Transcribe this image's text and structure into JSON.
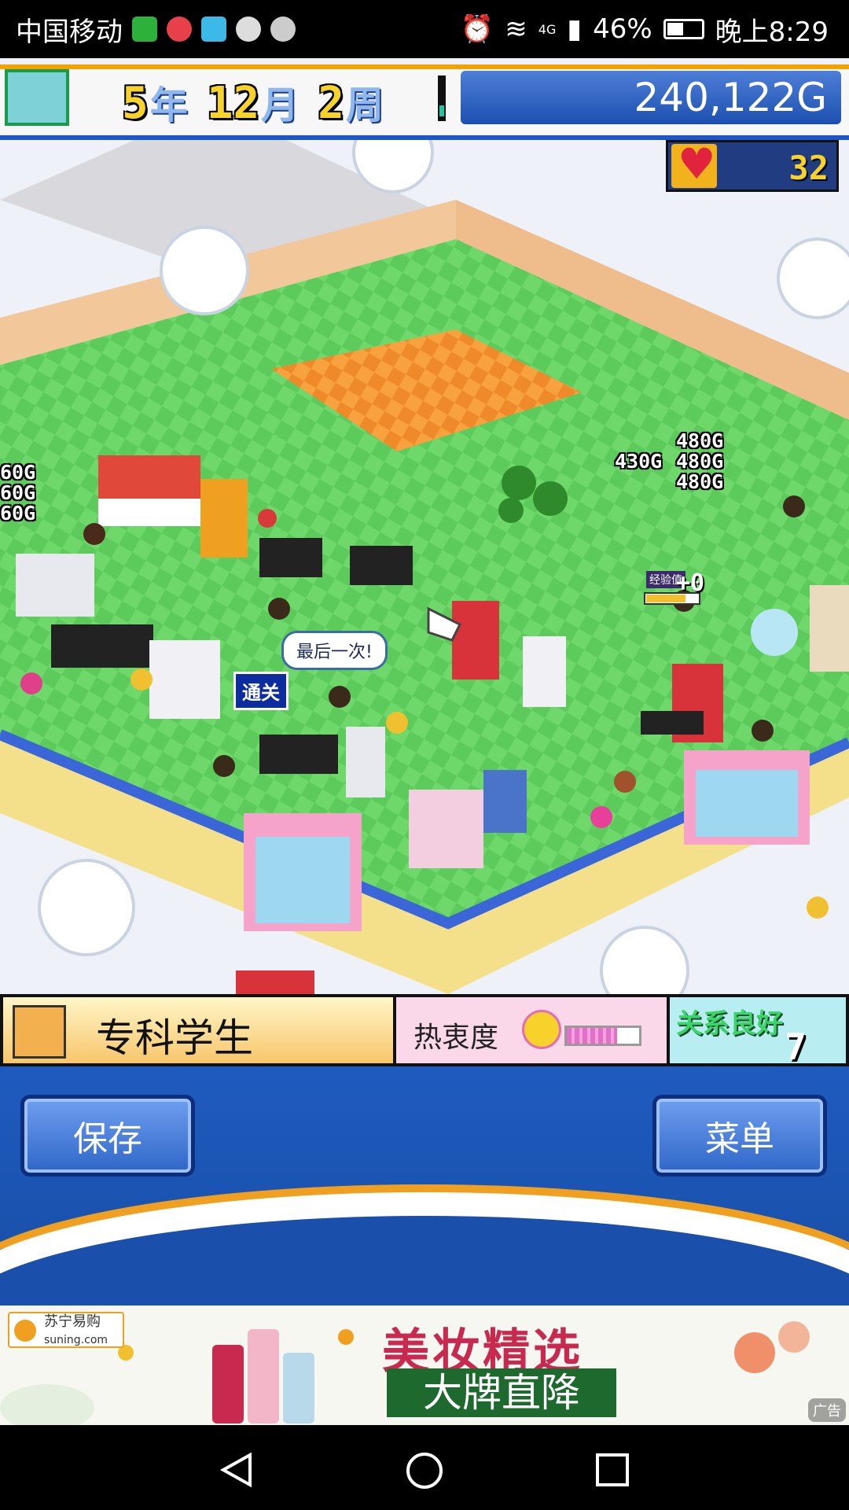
{
  "status_bar": {
    "carrier": "中国移动",
    "signal": "4G",
    "battery": "46%",
    "time": "晚上8:29"
  },
  "hud": {
    "year": "5",
    "year_unit": "年",
    "month": "12",
    "month_unit": "月",
    "week": "2",
    "week_unit": "周",
    "money": "240,122G",
    "hearts": "32"
  },
  "scene": {
    "money_popups": [
      "480G",
      "430G",
      "480G",
      "480G"
    ],
    "left_popups": [
      "60G",
      "60G",
      "60G"
    ],
    "exp_label": "经验值",
    "exp_gain": "+0",
    "speech": "最后一次!",
    "clear_tag": "通关"
  },
  "visitor": {
    "name": "专科学生",
    "enthusiasm_label": "热衷度",
    "enthusiasm_level": 0.7,
    "relationship_label": "关系良好",
    "relationship_value": "7"
  },
  "controls": {
    "save_label": "保存",
    "menu_label": "菜单"
  },
  "ad": {
    "brand": "苏宁易购",
    "brand_url": "suning.com",
    "headline": "美妆精选",
    "subline": "大牌直降",
    "tag": "广告"
  },
  "colors": {
    "accent_blue": "#1d56c9",
    "gold": "#f6d22a",
    "floor_green": "#6ed86b",
    "carpet_orange": "#f59a3a"
  }
}
